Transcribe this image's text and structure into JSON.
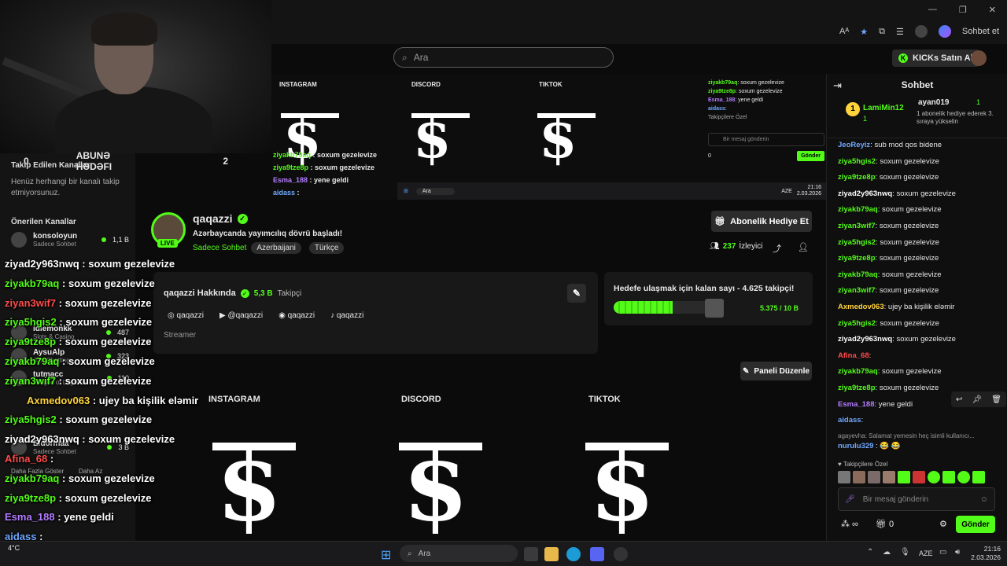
{
  "browser": {
    "sohbet_et": "Sohbet et",
    "min": "—",
    "max": "❐",
    "close": "✕"
  },
  "search": {
    "placeholder": "Ara"
  },
  "kicks": {
    "label": "KICKs Satın Al"
  },
  "subgoal": {
    "left": "0",
    "label": "ABUNƏ HƏDƏFI",
    "right": "2"
  },
  "left_sidebar": {
    "following_title": "Takip Edilen Kanallar",
    "following_empty": "Henüz herhangi bir kanalı takip etmiyorsunuz.",
    "suggested_title": "Önerilen Kanallar",
    "items": [
      {
        "name": "konsoloyun",
        "sub": "Sadece Sohbet",
        "viewers": "1,1 B"
      },
      {
        "name": "idlemonkk",
        "sub": "Slots & Casino",
        "viewers": "487"
      },
      {
        "name": "AysuAlp",
        "sub": "Just Chatting",
        "viewers": "323"
      },
      {
        "name": "tutmacc",
        "sub": "League of Legends",
        "viewers": "110"
      },
      {
        "name": "Eldorinaa",
        "sub": "Sadece Sohbet",
        "viewers": "3 B"
      }
    ],
    "show_more": "Daha Fazla Göster",
    "show_less": "Daha Az"
  },
  "pip": {
    "cols": [
      "INSTAGRAM",
      "DISCORD",
      "TIKTOK"
    ],
    "chat_lines": [
      {
        "user": "ziyakb79aq",
        "text": "soxum gezelevize"
      },
      {
        "user": "ziya9tze8p",
        "text": "soxum gezelevize"
      },
      {
        "user": "Esma_188",
        "text": "yene geldi"
      },
      {
        "user": "aidass",
        "text": ":"
      }
    ],
    "right_lines": [
      {
        "user": "ziyakb79aq",
        "text": "soxum gezelevize"
      },
      {
        "user": "ziya9tze8p",
        "text": "soxum gezelevize"
      },
      {
        "user": "Esma_188",
        "text": "yene geldi"
      },
      {
        "user": "aidass",
        "text": ""
      }
    ],
    "followers_only": "Takipçilere Özel",
    "input_placeholder": "Bir mesaj gönderin",
    "send": "Gönder",
    "count": "0",
    "taskbar_search": "Ara",
    "lang": "AZE",
    "time": "21:16",
    "date": "2.03.2026"
  },
  "channel": {
    "name": "qaqazzi",
    "title": "Azərbaycanda yayımcılıq dövrü başladı!",
    "category": "Sadece Sohbet",
    "tags": [
      "Azerbaijani",
      "Türkçe"
    ],
    "live": "LIVE",
    "gift_button": "Abonelik Hediye Et",
    "viewers": "237",
    "viewers_label": "İzleyici"
  },
  "about": {
    "title": "qaqazzi Hakkında",
    "followers": "5,3 B",
    "followers_label": "Takipçi",
    "socials": [
      "qaqazzi",
      "@qaqazzi",
      "qaqazzi",
      "qaqazzi"
    ],
    "role": "Streamer"
  },
  "goal": {
    "title": "Hedefe ulaşmak için kalan sayı - 4.625 takipçi!",
    "progress_text": "5.375 / 10 B",
    "progress": 0.5375
  },
  "panel_button": "Paneli Düzenle",
  "lower_cols": [
    "INSTAGRAM",
    "DISCORD",
    "TIKTOK"
  ],
  "overlay_chat": [
    {
      "user": "ziyad2y963nwq",
      "text": ": soxum gezelevize",
      "color": "#ffffff"
    },
    {
      "user": "ziyakb79aq",
      "text": ": soxum gezelevize",
      "color": "#53fc18"
    },
    {
      "user": "ziyan3wif7",
      "text": ": soxum gezelevize",
      "color": "#ff4b4b"
    },
    {
      "user": "ziya5hgis2",
      "text": ": soxum gezelevize",
      "color": "#53fc18"
    },
    {
      "user": "ziya9tze8p",
      "text": ": soxum gezelevize",
      "color": "#53fc18"
    },
    {
      "user": "ziyakb79aq",
      "text": ": soxum gezelevize",
      "color": "#53fc18"
    },
    {
      "user": "ziyan3wif7",
      "text": ": soxum gezelevize",
      "color": "#53fc18"
    },
    {
      "user": "Axmedov063",
      "text": ": ujey ba kişilik eləmir",
      "color": "#ffd43b"
    },
    {
      "user": "ziya5hgis2",
      "text": ": soxum gezelevize",
      "color": "#53fc18"
    },
    {
      "user": "ziyad2y963nwq",
      "text": ": soxum gezelevize",
      "color": "#ffffff"
    },
    {
      "user": "Afina_68",
      "text": ":",
      "color": "#ff4b4b"
    },
    {
      "user": "ziyakb79aq",
      "text": ": soxum gezelevize",
      "color": "#53fc18"
    },
    {
      "user": "ziya9tze8p",
      "text": ": soxum gezelevize",
      "color": "#53fc18"
    },
    {
      "user": "Esma_188",
      "text": ": yene geldi",
      "color": "#b47cff"
    },
    {
      "user": "aidass",
      "text": ":",
      "color": "#6fa8ff"
    },
    {
      "user": "nurulu329",
      "text": ":",
      "color": "#6fa8ff"
    }
  ],
  "chat": {
    "title": "Sohbet",
    "pinned": {
      "user1": "LamiMin12",
      "count1": "1",
      "user2": "ayan019",
      "count2": "1",
      "note": "1 abonelik hediye ederek 3. sıraya yükselin"
    },
    "messages": [
      {
        "user": "JeoReyiz",
        "text": "sub mod qos bidene",
        "color": "#6fa8ff"
      },
      {
        "user": "ziya5hgis2",
        "text": "soxum gezelevize",
        "color": "#53fc18"
      },
      {
        "user": "ziya9tze8p",
        "text": "soxum gezelevize",
        "color": "#53fc18"
      },
      {
        "user": "ziyad2y963nwq",
        "text": "soxum gezelevize",
        "color": "#ffffff"
      },
      {
        "user": "ziyakb79aq",
        "text": "soxum gezelevize",
        "color": "#53fc18"
      },
      {
        "user": "ziyan3wif7",
        "text": "soxum gezelevize",
        "color": "#53fc18"
      },
      {
        "user": "ziya5hgis2",
        "text": "soxum gezelevize",
        "color": "#53fc18"
      },
      {
        "user": "ziya9tze8p",
        "text": "soxum gezelevize",
        "color": "#53fc18"
      },
      {
        "user": "ziyakb79aq",
        "text": "soxum gezelevize",
        "color": "#53fc18"
      },
      {
        "user": "ziyan3wif7",
        "text": "soxum gezelevize",
        "color": "#53fc18"
      },
      {
        "user": "Axmedov063",
        "text": "ujey ba kişilik eləmir",
        "color": "#ffd43b"
      },
      {
        "user": "ziya5hgis2",
        "text": "soxum gezelevize",
        "color": "#53fc18"
      },
      {
        "user": "ziyad2y963nwq",
        "text": "soxum gezelevize",
        "color": "#ffffff"
      },
      {
        "user": "Afina_68",
        "text": "",
        "color": "#ff4b4b"
      },
      {
        "user": "ziyakb79aq",
        "text": "soxum gezelevize",
        "color": "#53fc18"
      },
      {
        "user": "ziya9tze8p",
        "text": "soxum gezelevize",
        "color": "#53fc18"
      },
      {
        "user": "Esma_188",
        "text": "yene geldi",
        "color": "#b47cff"
      },
      {
        "user": "aidass",
        "text": "",
        "color": "#6fa8ff"
      }
    ],
    "reply_preview": "agayevha: Salamat yemesin heç isimli kullanıcı...",
    "last_user": "nurulu329",
    "followers_only": "Takipçilere Özel",
    "input_placeholder": "Bir mesaj gönderin",
    "count": "0",
    "send": "Gönder"
  },
  "taskbar": {
    "search": "Ara",
    "temp": "4°C",
    "lang": "AZE",
    "time": "21:16",
    "date": "2.03.2026"
  }
}
